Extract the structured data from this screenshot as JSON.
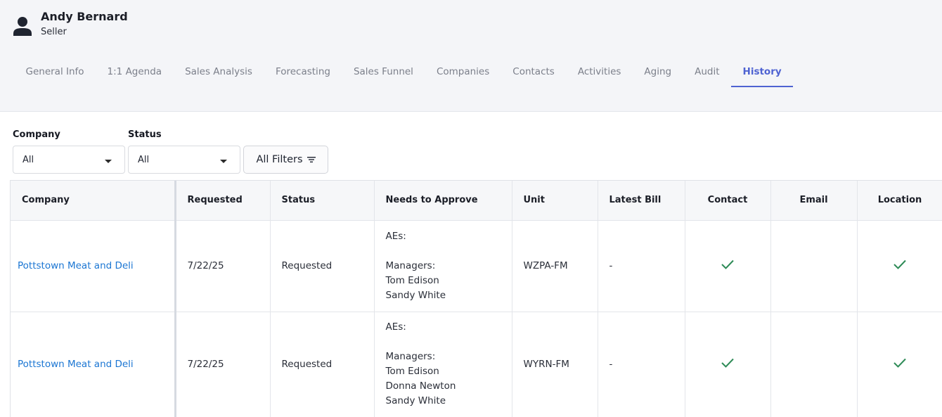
{
  "user": {
    "name": "Andy Bernard",
    "role": "Seller",
    "icon": "person-icon"
  },
  "tabs": [
    {
      "label": "General Info",
      "active": false
    },
    {
      "label": "1:1 Agenda",
      "active": false
    },
    {
      "label": "Sales Analysis",
      "active": false
    },
    {
      "label": "Forecasting",
      "active": false
    },
    {
      "label": "Sales Funnel",
      "active": false
    },
    {
      "label": "Companies",
      "active": false
    },
    {
      "label": "Contacts",
      "active": false
    },
    {
      "label": "Activities",
      "active": false
    },
    {
      "label": "Aging",
      "active": false
    },
    {
      "label": "Audit",
      "active": false
    },
    {
      "label": "History",
      "active": true
    }
  ],
  "filters": {
    "company": {
      "label": "Company",
      "value": "All"
    },
    "status": {
      "label": "Status",
      "value": "All"
    },
    "all_filters_label": "All Filters"
  },
  "table": {
    "headers": {
      "company": "Company",
      "requested": "Requested",
      "status": "Status",
      "needs_to_approve": "Needs to Approve",
      "unit": "Unit",
      "latest_bill": "Latest Bill",
      "contact": "Contact",
      "email": "Email",
      "location": "Location"
    },
    "rows": [
      {
        "company": "Pottstown Meat and Deli",
        "requested": "7/22/25",
        "status": "Requested",
        "approve": {
          "aes_label": "AEs:",
          "managers_label": "Managers:",
          "managers": [
            "Tom Edison",
            "Sandy White"
          ]
        },
        "unit": "WZPA-FM",
        "latest_bill": "-",
        "contact": true,
        "email": false,
        "location": true
      },
      {
        "company": "Pottstown Meat and Deli",
        "requested": "7/22/25",
        "status": "Requested",
        "approve": {
          "aes_label": "AEs:",
          "managers_label": "Managers:",
          "managers": [
            "Tom Edison",
            "Donna Newton",
            "Sandy White"
          ]
        },
        "unit": "WYRN-FM",
        "latest_bill": "-",
        "contact": true,
        "email": false,
        "location": true
      }
    ]
  },
  "colors": {
    "accent": "#4f63d2",
    "link": "#1b76d3",
    "check": "#2e8b57",
    "header_bg": "#f4f5f8"
  }
}
